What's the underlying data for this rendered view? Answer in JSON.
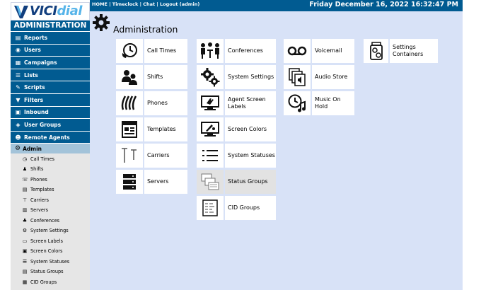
{
  "logo": {
    "part1": "VICI",
    "part2": "dial"
  },
  "topbar": {
    "links": "HOME | Timeclock | Chat | Logout (admin)",
    "datetime": "Friday December 16, 2022 16:32:47 PM"
  },
  "sidebar": {
    "title": "ADMINISTRATION",
    "items": [
      {
        "label": "Reports",
        "icon": "reports-icon"
      },
      {
        "label": "Users",
        "icon": "users-icon"
      },
      {
        "label": "Campaigns",
        "icon": "campaigns-icon"
      },
      {
        "label": "Lists",
        "icon": "lists-icon"
      },
      {
        "label": "Scripts",
        "icon": "scripts-icon"
      },
      {
        "label": "Filters",
        "icon": "filters-icon"
      },
      {
        "label": "Inbound",
        "icon": "inbound-icon"
      },
      {
        "label": "User Groups",
        "icon": "user-groups-icon"
      },
      {
        "label": "Remote Agents",
        "icon": "remote-agents-icon"
      }
    ],
    "active": {
      "label": "Admin",
      "icon": "gear-icon"
    },
    "subitems": [
      "Call Times",
      "Shifts",
      "Phones",
      "Templates",
      "Carriers",
      "Servers",
      "Conferences",
      "System Settings",
      "Screen Labels",
      "Screen Colors",
      "System Statuses",
      "Status Groups",
      "CID Groups"
    ]
  },
  "main": {
    "title": "Administration",
    "tiles": {
      "call_times": "Call Times",
      "shifts": "Shifts",
      "phones": "Phones",
      "templates": "Templates",
      "carriers": "Carriers",
      "servers": "Servers",
      "conferences": "Conferences",
      "system_settings": "System Settings",
      "agent_screen_labels": "Agent Screen Labels",
      "screen_colors": "Screen Colors",
      "system_statuses": "System Statuses",
      "status_groups": "Status Groups",
      "cid_groups": "CID Groups",
      "voicemail": "Voicemail",
      "audio_store": "Audio Store",
      "music_on_hold": "Music On Hold",
      "settings_containers": "Settings Containers"
    }
  },
  "colors": {
    "sidebar_bg": "#015b91",
    "main_bg": "#d8e2f7",
    "active_bg": "#a3c3d9",
    "subnav_bg": "#e6e6e6",
    "highlight_tile": "#e2e2e2"
  }
}
